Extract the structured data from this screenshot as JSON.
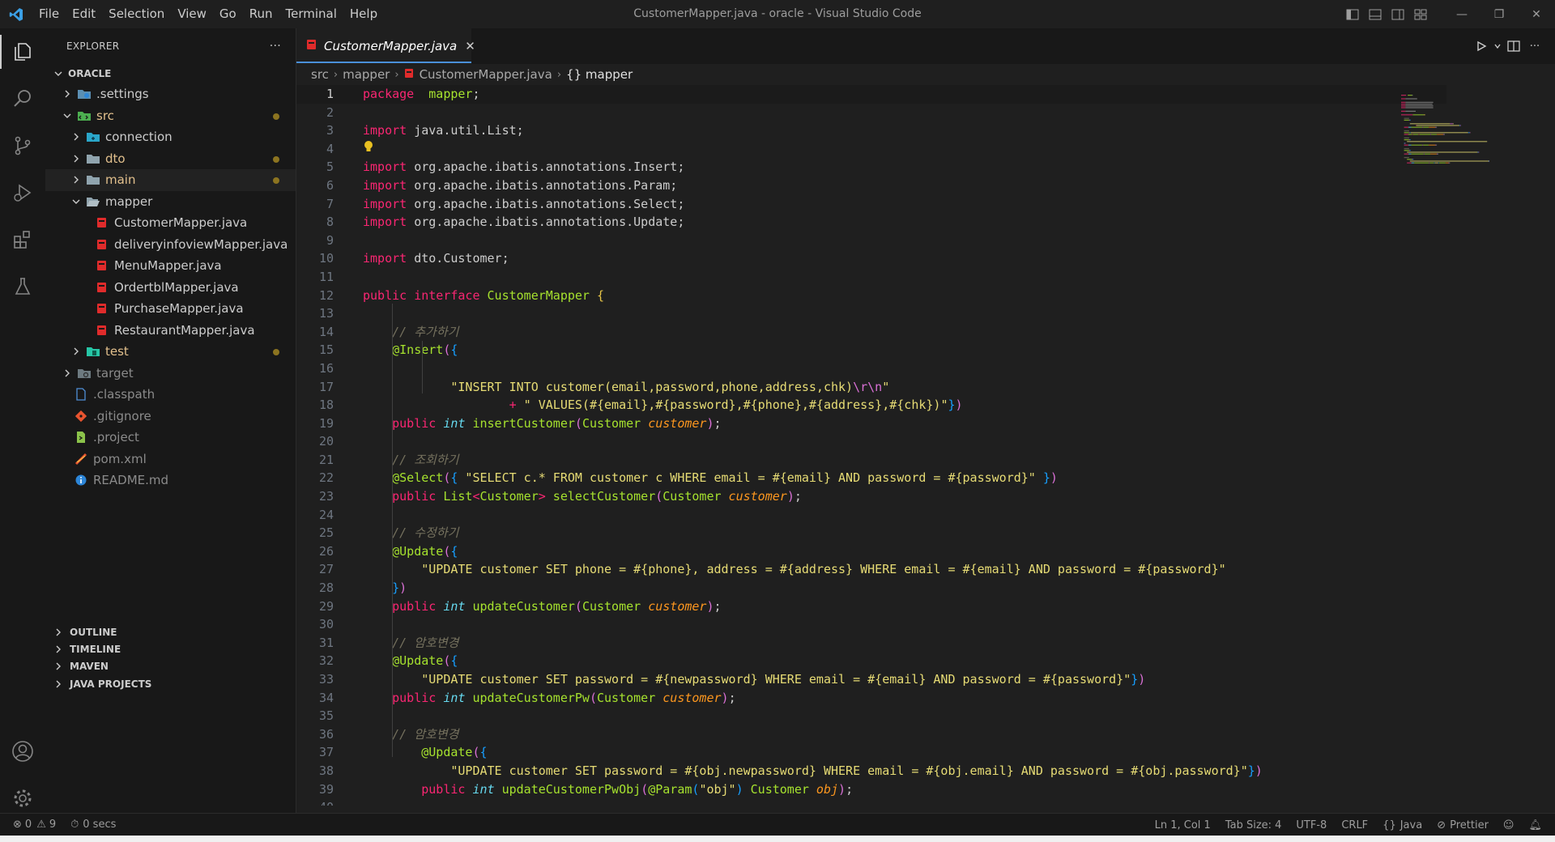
{
  "window": {
    "title": "CustomerMapper.java - oracle - Visual Studio Code",
    "menu": [
      "File",
      "Edit",
      "Selection",
      "View",
      "Go",
      "Run",
      "Terminal",
      "Help"
    ]
  },
  "sidebar": {
    "title": "EXPLORER",
    "more": "···",
    "root": "ORACLE",
    "items": [
      {
        "label": ".settings",
        "depth": 1,
        "type": "folder",
        "expanded": false,
        "color": "#cccccc",
        "icon": "settings-folder-icon",
        "dot": false
      },
      {
        "label": "src",
        "depth": 1,
        "type": "folder",
        "expanded": true,
        "color": "#e2c08d",
        "icon": "src-folder-icon",
        "dot": true
      },
      {
        "label": "connection",
        "depth": 2,
        "type": "folder",
        "expanded": false,
        "color": "#cccccc",
        "icon": "connection-folder-icon",
        "dot": false
      },
      {
        "label": "dto",
        "depth": 2,
        "type": "folder",
        "expanded": false,
        "color": "#e2c08d",
        "icon": "folder-icon",
        "dot": true
      },
      {
        "label": "main",
        "depth": 2,
        "type": "folder",
        "expanded": false,
        "color": "#e2c08d",
        "icon": "folder-icon",
        "dot": true,
        "selected": true
      },
      {
        "label": "mapper",
        "depth": 2,
        "type": "folder",
        "expanded": true,
        "color": "#cccccc",
        "icon": "folder-open-icon",
        "dot": false
      },
      {
        "label": "CustomerMapper.java",
        "depth": 3,
        "type": "file",
        "color": "#cccccc",
        "icon": "java-file-icon",
        "dot": false
      },
      {
        "label": "deliveryinfoviewMapper.java",
        "depth": 3,
        "type": "file",
        "color": "#cccccc",
        "icon": "java-file-icon",
        "dot": false
      },
      {
        "label": "MenuMapper.java",
        "depth": 3,
        "type": "file",
        "color": "#cccccc",
        "icon": "java-file-icon",
        "dot": false
      },
      {
        "label": "OrdertblMapper.java",
        "depth": 3,
        "type": "file",
        "color": "#cccccc",
        "icon": "java-file-icon",
        "dot": false
      },
      {
        "label": "PurchaseMapper.java",
        "depth": 3,
        "type": "file",
        "color": "#cccccc",
        "icon": "java-file-icon",
        "dot": false
      },
      {
        "label": "RestaurantMapper.java",
        "depth": 3,
        "type": "file",
        "color": "#cccccc",
        "icon": "java-file-icon",
        "dot": false
      },
      {
        "label": "test",
        "depth": 2,
        "type": "folder",
        "expanded": false,
        "color": "#e2c08d",
        "icon": "test-folder-icon",
        "dot": true
      },
      {
        "label": "target",
        "depth": 1,
        "type": "folder",
        "expanded": false,
        "color": "#8b8b8b",
        "icon": "target-folder-icon",
        "dot": false
      },
      {
        "label": ".classpath",
        "depth": 1,
        "type": "file",
        "color": "#8b8b8b",
        "icon": "classpath-file-icon",
        "dot": false
      },
      {
        "label": ".gitignore",
        "depth": 1,
        "type": "file",
        "color": "#8b8b8b",
        "icon": "git-file-icon",
        "dot": false
      },
      {
        "label": ".project",
        "depth": 1,
        "type": "file",
        "color": "#8b8b8b",
        "icon": "project-file-icon",
        "dot": false
      },
      {
        "label": "pom.xml",
        "depth": 1,
        "type": "file",
        "color": "#8b8b8b",
        "icon": "maven-file-icon",
        "dot": false
      },
      {
        "label": "README.md",
        "depth": 1,
        "type": "file",
        "color": "#8b8b8b",
        "icon": "info-file-icon",
        "dot": false
      }
    ],
    "panels": [
      "OUTLINE",
      "TIMELINE",
      "MAVEN",
      "JAVA PROJECTS"
    ]
  },
  "editor": {
    "tab": {
      "label": "CustomerMapper.java",
      "close": "✕"
    },
    "breadcrumb": [
      "src",
      "mapper",
      "CustomerMapper.java",
      "{} mapper"
    ],
    "current_line": 1,
    "lines": [
      [
        [
          "kw",
          "package"
        ],
        [
          "",
          "  "
        ],
        [
          "cl",
          "mapper"
        ],
        [
          "",
          ";"
        ]
      ],
      [],
      [
        [
          "kw",
          "import"
        ],
        [
          "",
          " java.util.List;"
        ]
      ],
      [],
      [
        [
          "kw",
          "import"
        ],
        [
          "",
          " org.apache.ibatis.annotations.Insert;"
        ]
      ],
      [
        [
          "kw",
          "import"
        ],
        [
          "",
          " org.apache.ibatis.annotations.Param;"
        ]
      ],
      [
        [
          "kw",
          "import"
        ],
        [
          "",
          " org.apache.ibatis.annotations.Select;"
        ]
      ],
      [
        [
          "kw",
          "import"
        ],
        [
          "",
          " org.apache.ibatis.annotations.Update;"
        ]
      ],
      [],
      [
        [
          "kw",
          "import"
        ],
        [
          "",
          " dto.Customer;"
        ]
      ],
      [],
      [
        [
          "kw",
          "public"
        ],
        [
          "",
          ""
        ],
        [
          "kw",
          " interface"
        ],
        [
          "cl",
          " CustomerMapper"
        ],
        [
          "b1",
          " {"
        ]
      ],
      [],
      [
        [
          "",
          "    "
        ],
        [
          "cm",
          "// 추가하기"
        ]
      ],
      [
        [
          "",
          "    "
        ],
        [
          "an",
          "@Insert"
        ],
        [
          "b2",
          "("
        ],
        [
          "b3",
          "{"
        ]
      ],
      [],
      [
        [
          "",
          "            "
        ],
        [
          "st",
          "\"INSERT INTO customer(email,password,phone,address,chk)"
        ],
        [
          "b2",
          "\\r\\n"
        ],
        [
          "st",
          "\""
        ]
      ],
      [
        [
          "",
          "                    "
        ],
        [
          "kw",
          "+"
        ],
        [
          "st",
          " \" VALUES(#{email},#{password},#{phone},#{address},#{chk})\""
        ],
        [
          "b3",
          "}"
        ],
        [
          "b2",
          ")"
        ]
      ],
      [
        [
          "",
          "    "
        ],
        [
          "kw",
          "public"
        ],
        [
          "ty",
          " int"
        ],
        [
          "fn",
          " insertCustomer"
        ],
        [
          "b2",
          "("
        ],
        [
          "cl",
          "Customer"
        ],
        [
          "pa",
          " customer"
        ],
        [
          "b2",
          ")"
        ],
        [
          "",
          ";"
        ]
      ],
      [],
      [
        [
          "",
          "    "
        ],
        [
          "cm",
          "// 조회하기"
        ]
      ],
      [
        [
          "",
          "    "
        ],
        [
          "an",
          "@Select"
        ],
        [
          "b2",
          "("
        ],
        [
          "b3",
          "{"
        ],
        [
          "st",
          " \"SELECT c.* FROM customer c WHERE email = #{email} AND password = #{password}\""
        ],
        [
          "b3",
          " }"
        ],
        [
          "b2",
          ")"
        ]
      ],
      [
        [
          "",
          "    "
        ],
        [
          "kw",
          "public"
        ],
        [
          "cl",
          " List"
        ],
        [
          "kw",
          "<"
        ],
        [
          "cl",
          "Customer"
        ],
        [
          "kw",
          ">"
        ],
        [
          "fn",
          " selectCustomer"
        ],
        [
          "b2",
          "("
        ],
        [
          "cl",
          "Customer"
        ],
        [
          "pa",
          " customer"
        ],
        [
          "b2",
          ")"
        ],
        [
          "",
          ";"
        ]
      ],
      [],
      [
        [
          "",
          "    "
        ],
        [
          "cm",
          "// 수정하기"
        ]
      ],
      [
        [
          "",
          "    "
        ],
        [
          "an",
          "@Update"
        ],
        [
          "b2",
          "("
        ],
        [
          "b3",
          "{"
        ]
      ],
      [
        [
          "",
          "        "
        ],
        [
          "st",
          "\"UPDATE customer SET phone = #{phone}, address = #{address} WHERE email = #{email} AND password = #{password}\""
        ]
      ],
      [
        [
          "",
          "    "
        ],
        [
          "b3",
          "}"
        ],
        [
          "b2",
          ")"
        ]
      ],
      [
        [
          "",
          "    "
        ],
        [
          "kw",
          "public"
        ],
        [
          "ty",
          " int"
        ],
        [
          "fn",
          " updateCustomer"
        ],
        [
          "b2",
          "("
        ],
        [
          "cl",
          "Customer"
        ],
        [
          "pa",
          " customer"
        ],
        [
          "b2",
          ")"
        ],
        [
          "",
          ";"
        ]
      ],
      [],
      [
        [
          "",
          "    "
        ],
        [
          "cm",
          "// 암호변경"
        ]
      ],
      [
        [
          "",
          "    "
        ],
        [
          "an",
          "@Update"
        ],
        [
          "b2",
          "("
        ],
        [
          "b3",
          "{"
        ]
      ],
      [
        [
          "",
          "        "
        ],
        [
          "st",
          "\"UPDATE customer SET password = #{newpassword} WHERE email = #{email} AND password = #{password}\""
        ],
        [
          "b3",
          "}"
        ],
        [
          "b2",
          ")"
        ]
      ],
      [
        [
          "",
          "    "
        ],
        [
          "kw",
          "public"
        ],
        [
          "ty",
          " int"
        ],
        [
          "fn",
          " updateCustomerPw"
        ],
        [
          "b2",
          "("
        ],
        [
          "cl",
          "Customer"
        ],
        [
          "pa",
          " customer"
        ],
        [
          "b2",
          ")"
        ],
        [
          "",
          ";"
        ]
      ],
      [],
      [
        [
          "",
          "    "
        ],
        [
          "cm",
          "// 암호변경"
        ]
      ],
      [
        [
          "",
          "        "
        ],
        [
          "an",
          "@Update"
        ],
        [
          "b2",
          "("
        ],
        [
          "b3",
          "{"
        ]
      ],
      [
        [
          "",
          "            "
        ],
        [
          "st",
          "\"UPDATE customer SET password = #{obj.newpassword} WHERE email = #{obj.email} AND password = #{obj.password}\""
        ],
        [
          "b3",
          "}"
        ],
        [
          "b2",
          ")"
        ]
      ],
      [
        [
          "",
          "        "
        ],
        [
          "kw",
          "public"
        ],
        [
          "ty",
          " int"
        ],
        [
          "fn",
          " updateCustomerPwObj"
        ],
        [
          "b2",
          "("
        ],
        [
          "an",
          "@Param"
        ],
        [
          "b3",
          "("
        ],
        [
          "st",
          "\"obj\""
        ],
        [
          "b3",
          ")"
        ],
        [
          "cl",
          " Customer"
        ],
        [
          "pa",
          " obj"
        ],
        [
          "b2",
          ")"
        ],
        [
          "",
          ";"
        ]
      ],
      []
    ]
  },
  "status": {
    "errors": "0",
    "warnings": "9",
    "timer": "0 secs",
    "position": "Ln 1, Col 1",
    "tab_size": "Tab Size: 4",
    "encoding": "UTF-8",
    "eol": "CRLF",
    "language": "Java",
    "formatter": "Prettier"
  },
  "colors": {
    "accent": "#4a90d9",
    "modified_dot": "#8c7420",
    "java_icon": "#e02b2b"
  }
}
